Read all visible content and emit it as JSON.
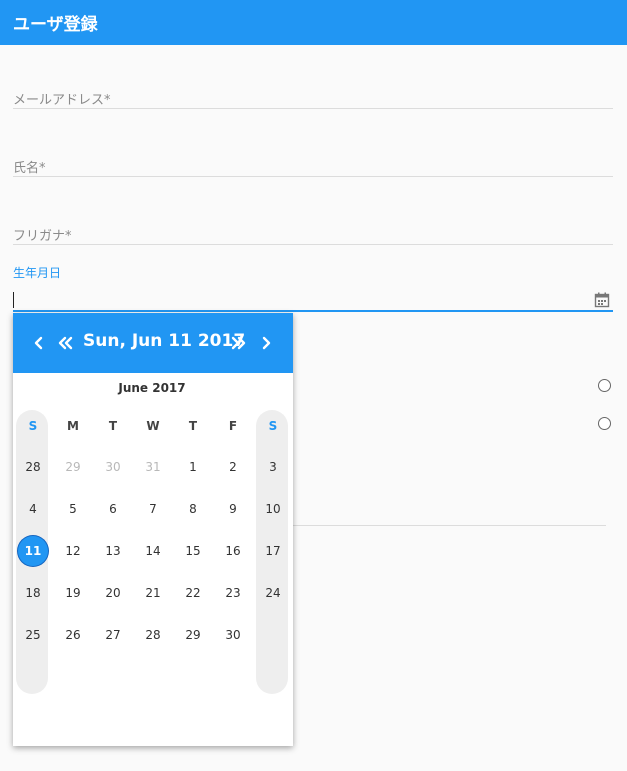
{
  "app": {
    "title": "ユーザ登録"
  },
  "form": {
    "email_label": "メールアドレス*",
    "name_label": "氏名*",
    "kana_label": "フリガナ*",
    "birthday_label": "生年月日"
  },
  "datepicker": {
    "header_date": "Sun, Jun 11 2017",
    "month_label": "June 2017",
    "weekdays": [
      "S",
      "M",
      "T",
      "W",
      "T",
      "F",
      "S"
    ],
    "weeks": [
      [
        "28",
        "29",
        "30",
        "31",
        "1",
        "2",
        "3"
      ],
      [
        "4",
        "5",
        "6",
        "7",
        "8",
        "9",
        "10"
      ],
      [
        "11",
        "12",
        "13",
        "14",
        "15",
        "16",
        "17"
      ],
      [
        "18",
        "19",
        "20",
        "21",
        "22",
        "23",
        "24"
      ],
      [
        "25",
        "26",
        "27",
        "28",
        "29",
        "30",
        ""
      ]
    ],
    "outside_month": [
      [
        0,
        1
      ],
      [
        0,
        2
      ],
      [
        0,
        3
      ]
    ],
    "selected": [
      2,
      0
    ],
    "accent_color": "#2196f3"
  },
  "icons": {
    "prev_month": "chevron-left-icon",
    "prev_year": "double-chevron-left-icon",
    "next_year": "double-chevron-right-icon",
    "next_month": "chevron-right-icon",
    "calendar": "calendar-icon"
  }
}
